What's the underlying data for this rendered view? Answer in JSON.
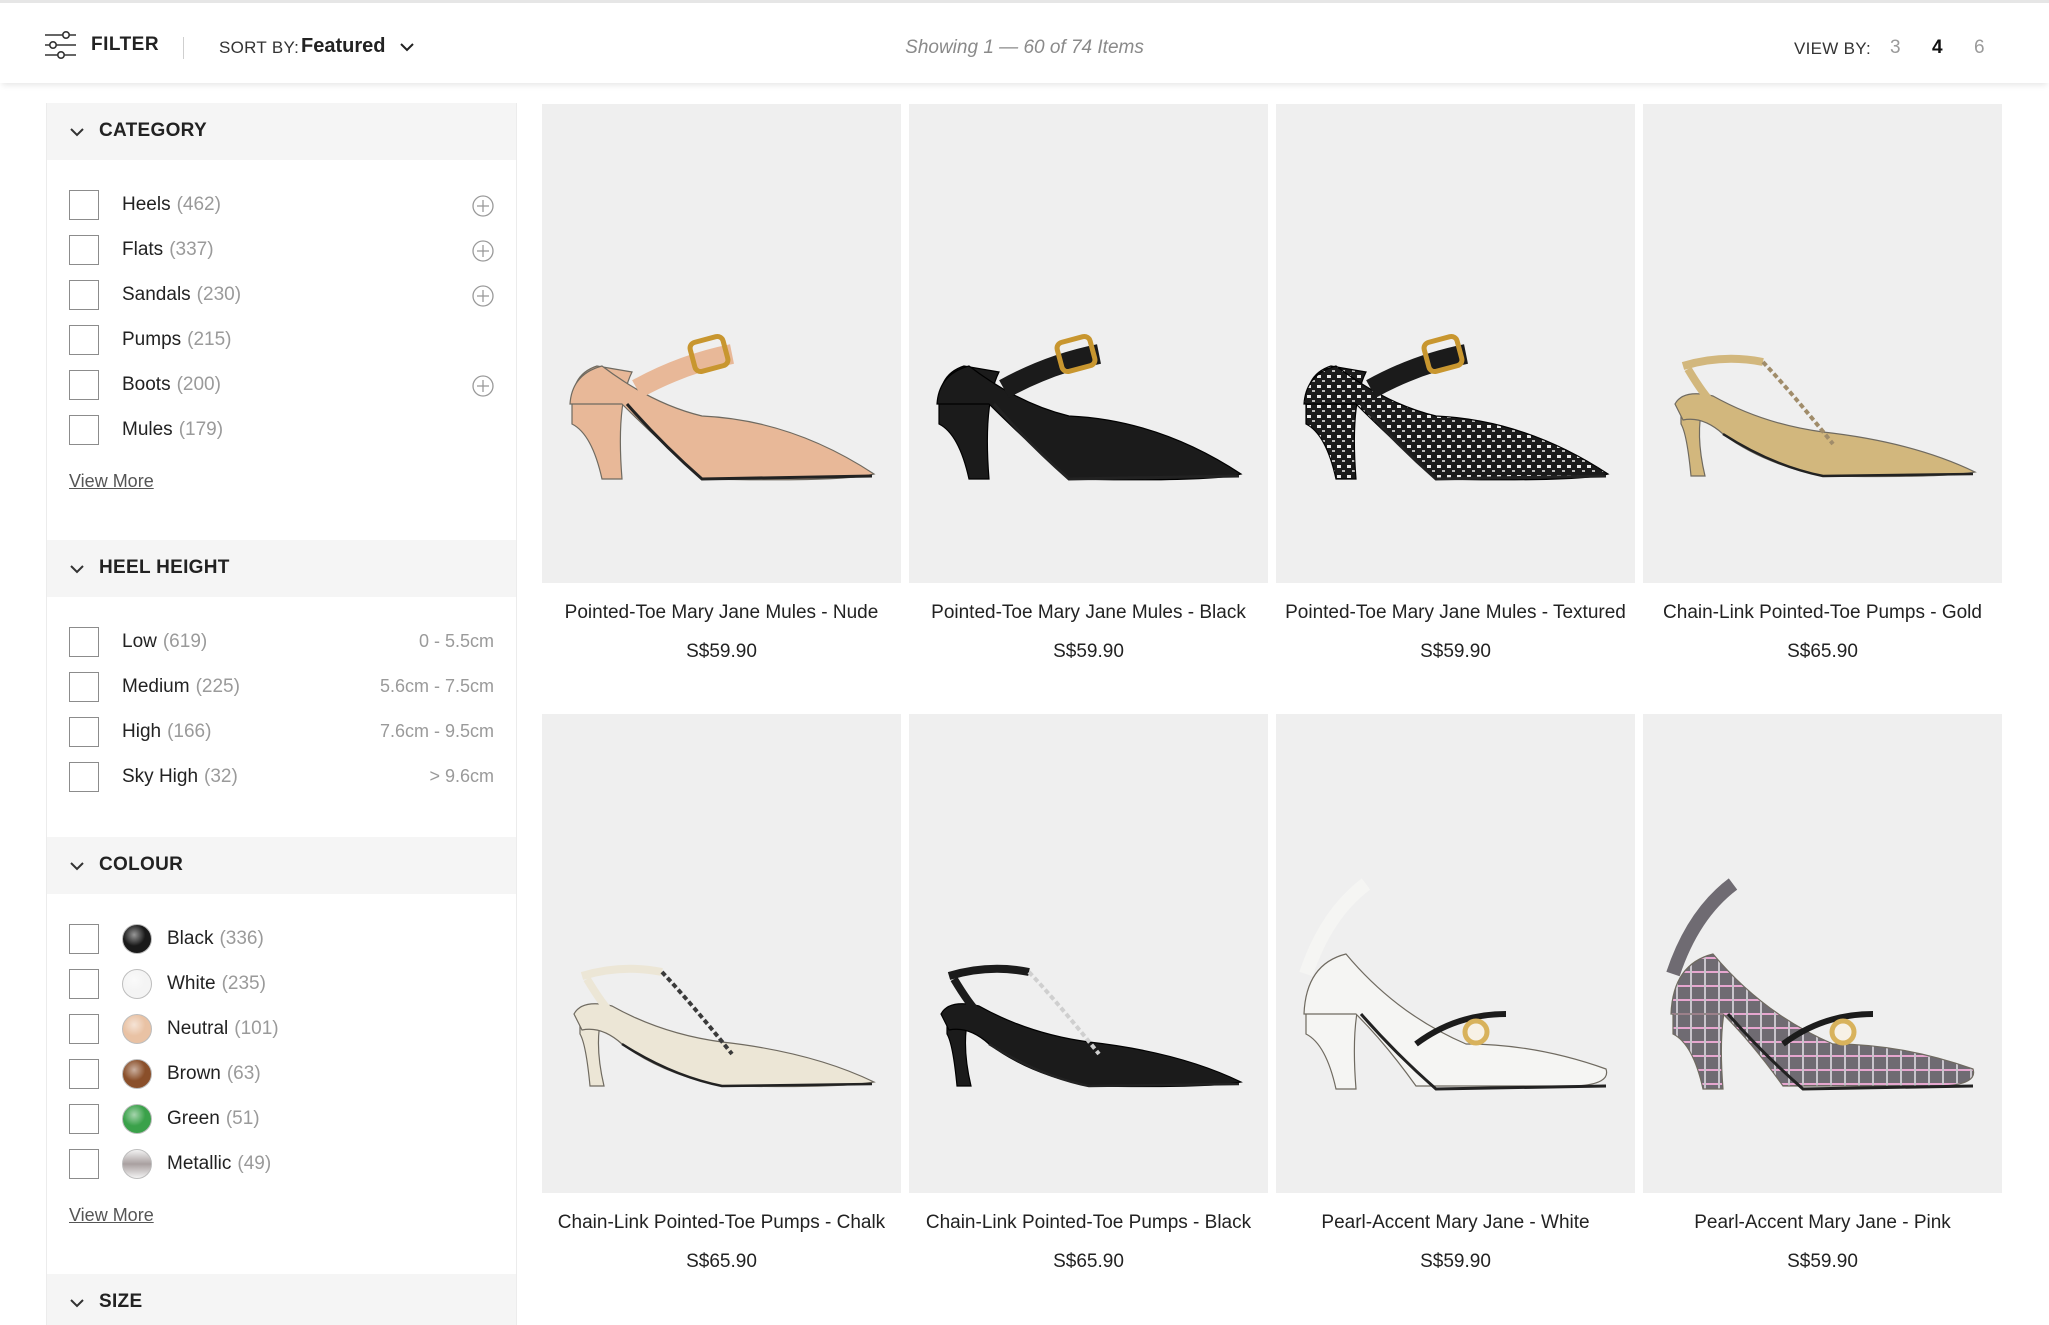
{
  "toolbar": {
    "filter_label": "FILTER",
    "sort_label": "SORT BY:",
    "sort_value": "Featured",
    "showing": "Showing 1 — 60 of 74 Items",
    "view_by_label": "VIEW BY:",
    "view_options": [
      "3",
      "4",
      "6"
    ],
    "view_selected": "4"
  },
  "sidebar": {
    "category": {
      "title": "CATEGORY",
      "items": [
        {
          "label": "Heels",
          "count": "(462)",
          "expandable": true
        },
        {
          "label": "Flats",
          "count": "(337)",
          "expandable": true
        },
        {
          "label": "Sandals",
          "count": "(230)",
          "expandable": true
        },
        {
          "label": "Pumps",
          "count": "(215)",
          "expandable": false
        },
        {
          "label": "Boots",
          "count": "(200)",
          "expandable": true
        },
        {
          "label": "Mules",
          "count": "(179)",
          "expandable": false
        }
      ],
      "view_more": "View More"
    },
    "heel_height": {
      "title": "HEEL HEIGHT",
      "items": [
        {
          "label": "Low",
          "count": "(619)",
          "range": "0 - 5.5cm"
        },
        {
          "label": "Medium",
          "count": "(225)",
          "range": "5.6cm - 7.5cm"
        },
        {
          "label": "High",
          "count": "(166)",
          "range": "7.6cm - 9.5cm"
        },
        {
          "label": "Sky High",
          "count": "(32)",
          "range": "> 9.6cm"
        }
      ]
    },
    "colour": {
      "title": "COLOUR",
      "items": [
        {
          "label": "Black",
          "count": "(336)",
          "swatch": "#1a1a1a"
        },
        {
          "label": "White",
          "count": "(235)",
          "swatch": "#f4f4f4"
        },
        {
          "label": "Neutral",
          "count": "(101)",
          "swatch": "#e9c2a4"
        },
        {
          "label": "Brown",
          "count": "(63)",
          "swatch": "#8a4f2a"
        },
        {
          "label": "Green",
          "count": "(51)",
          "swatch": "#3aa14a"
        },
        {
          "label": "Metallic",
          "count": "(49)",
          "swatch": "#c9c0c0"
        }
      ],
      "view_more": "View More"
    },
    "size": {
      "title": "SIZE"
    }
  },
  "products": [
    {
      "name": "Pointed-Toe Mary Jane Mules - Nude",
      "price": "S$59.90",
      "style": "mule",
      "color": "#e8b898",
      "accent": "#c8962f"
    },
    {
      "name": "Pointed-Toe Mary Jane Mules - Black",
      "price": "S$59.90",
      "style": "mule",
      "color": "#1b1b1b",
      "accent": "#c8962f"
    },
    {
      "name": "Pointed-Toe Mary Jane Mules - Textured",
      "price": "S$59.90",
      "style": "mule-textured",
      "color": "#1b1b1b",
      "accent": "#c8962f"
    },
    {
      "name": "Chain-Link Pointed-Toe Pumps - Gold",
      "price": "S$65.90",
      "style": "pump",
      "color": "#d2b77d",
      "accent": "#a08c6a"
    },
    {
      "name": "Chain-Link Pointed-Toe Pumps - Chalk",
      "price": "S$65.90",
      "style": "pump",
      "color": "#ece6d6",
      "accent": "#3a3a3a"
    },
    {
      "name": "Chain-Link Pointed-Toe Pumps - Black",
      "price": "S$65.90",
      "style": "pump",
      "color": "#1b1b1b",
      "accent": "#cfcfcf"
    },
    {
      "name": "Pearl-Accent Mary Jane - White",
      "price": "S$59.90",
      "style": "maryjane",
      "color": "#f5f5f3",
      "accent": "#d8b25c"
    },
    {
      "name": "Pearl-Accent Mary Jane - Pink",
      "price": "S$59.90",
      "style": "maryjane-plaid",
      "color": "#8a8590",
      "accent": "#d8b25c"
    }
  ]
}
